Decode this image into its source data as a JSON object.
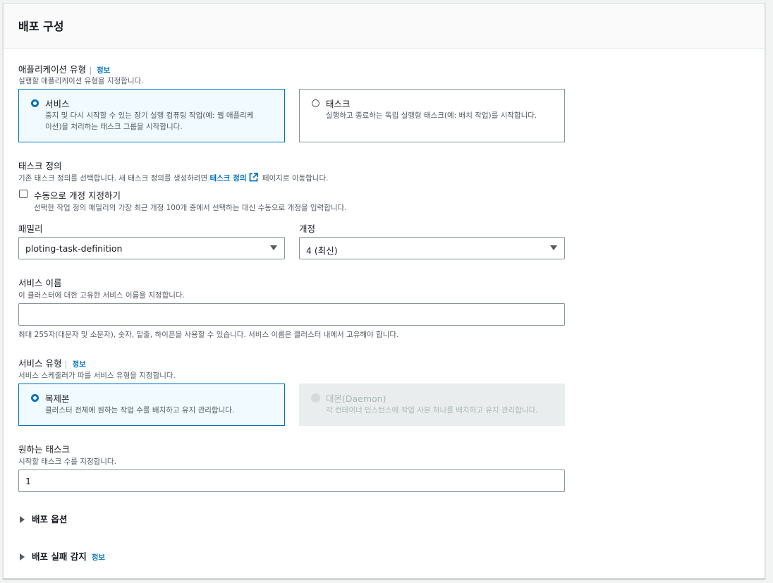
{
  "panel": {
    "title": "배포 구성"
  },
  "application_type": {
    "label": "애플리케이션 유형",
    "info": "정보",
    "description": "실행할 애플리케이션 유형을 지정합니다.",
    "options": [
      {
        "title": "서비스",
        "desc_line1": "중지 및 다시 시작할 수 있는 장기 실행 컴퓨팅 작업(예: 웹 애플리케",
        "desc_line2": "이션)을 처리하는 태스크 그룹을 시작합니다.",
        "selected": true
      },
      {
        "title": "태스크",
        "desc_line1": "실행하고 종료하는 독립 실행형 태스크(예: 배치 작업)를 시작합니다.",
        "selected": false
      }
    ]
  },
  "task_definition": {
    "label": "태스크 정의",
    "desc_before": "기존 태스크 정의를 선택합니다. 새 태스크 정의를 생성하려면 ",
    "desc_link": "태스크 정의",
    "desc_after": " 페이지로 이동합니다.",
    "manual_checkbox": {
      "label": "수동으로 개정 지정하기",
      "description": "선택한 작업 정의 패밀리의 가장 최근 개정 100개 중에서 선택하는 대신 수동으로 개정을 입력합니다.",
      "checked": false
    },
    "family": {
      "label": "패밀리",
      "value": "ploting-task-definition"
    },
    "revision": {
      "label": "개정",
      "value": "4 (최신)"
    }
  },
  "service_name": {
    "label": "서비스 이름",
    "description": "이 클러스터에 대한 고유한 서비스 이름을 지정합니다.",
    "value": "",
    "constraint": "최대 255자(대문자 및 소문자), 숫자, 밑줄, 하이픈을 사용할 수 있습니다. 서비스 이름은 클러스터 내에서 고유해야 합니다."
  },
  "service_type": {
    "label": "서비스 유형",
    "info": "정보",
    "description": "서비스 스케줄러가 따를 서비스 유형을 지정합니다.",
    "options": [
      {
        "title": "복제본",
        "desc": "클러스터 전체에 원하는 작업 수를 배치하고 유지 관리합니다.",
        "selected": true,
        "disabled": false
      },
      {
        "title": "대몬(Daemon)",
        "desc": "각 컨테이너 인스턴스에 작업 사본 하나를 배치하고 유지 관리합니다.",
        "selected": false,
        "disabled": true
      }
    ]
  },
  "desired_tasks": {
    "label": "원하는 태스크",
    "description": "시작할 태스크 수를 지정합니다.",
    "value": "1"
  },
  "expanders": {
    "deployment_options": "배포 옵션",
    "failure_detection": "배포 실패 감지",
    "failure_detection_info": "정보"
  }
}
